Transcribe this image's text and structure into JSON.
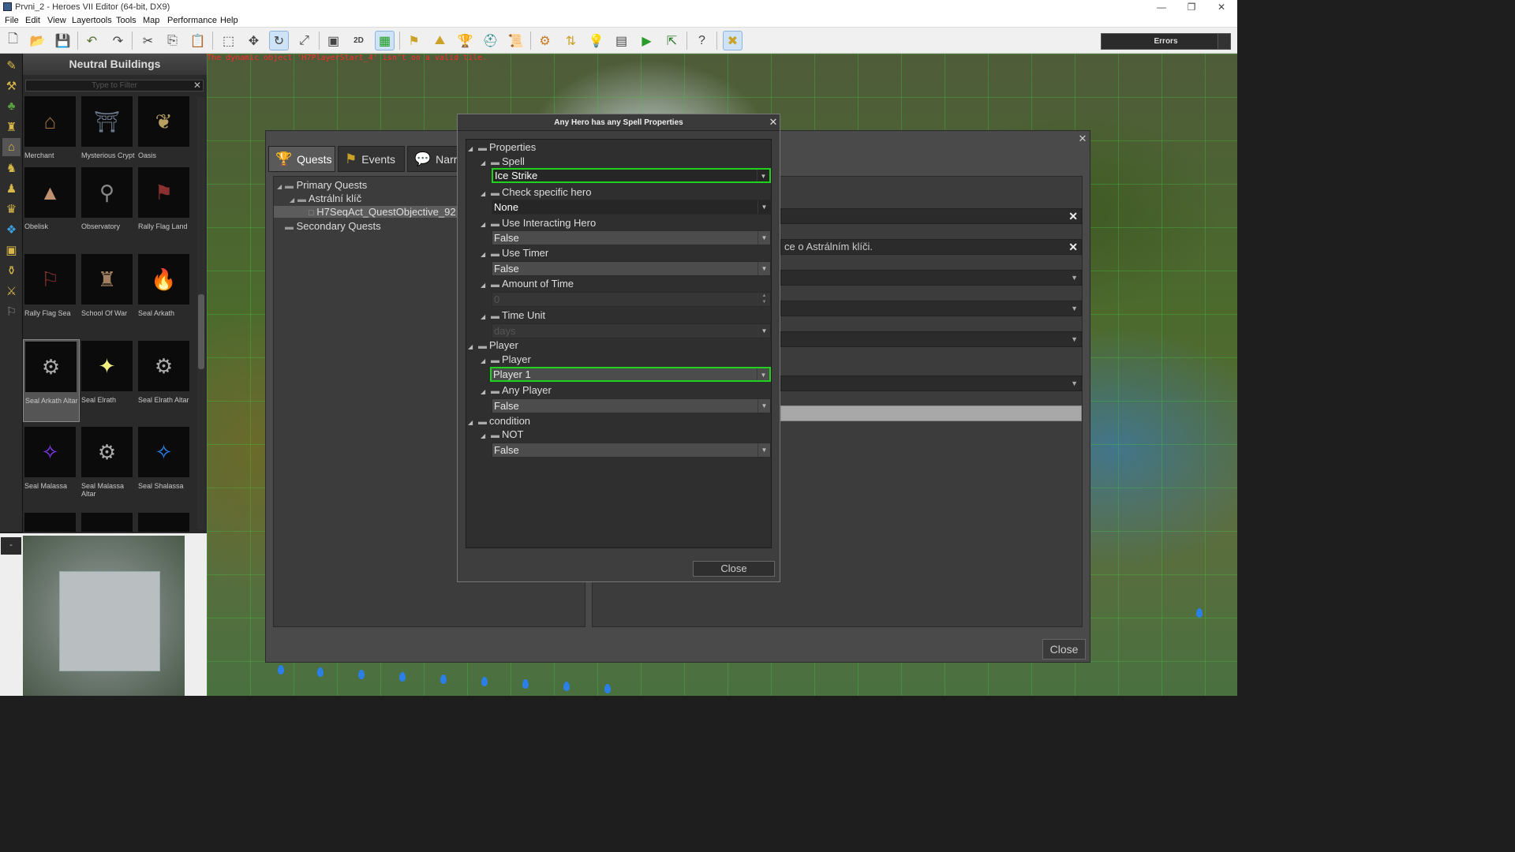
{
  "window": {
    "title": "Prvni_2 - Heroes VII Editor (64-bit, DX9)",
    "minimize": "—",
    "maximize": "❐",
    "close": "✕"
  },
  "menu": [
    "File",
    "Edit",
    "View",
    "Layertools",
    "Tools",
    "Map",
    "Performance",
    "Help"
  ],
  "toolbar": {
    "errors_label": "Errors"
  },
  "viewport": {
    "error_message": "The dynamic object 'H7PlayerStart_4' isn't on a valid tile."
  },
  "neutral_buildings": {
    "title": "Neutral Buildings",
    "filter_placeholder": "Type to Filter",
    "items": [
      {
        "label": "Merchant"
      },
      {
        "label": "Mysterious Crypt"
      },
      {
        "label": "Oasis"
      },
      {
        "label": "Obelisk"
      },
      {
        "label": "Observatory"
      },
      {
        "label": "Rally Flag Land"
      },
      {
        "label": "Rally Flag Sea"
      },
      {
        "label": "School Of War"
      },
      {
        "label": "Seal Arkath"
      },
      {
        "label": "Seal Arkath Altar"
      },
      {
        "label": "Seal Elrath"
      },
      {
        "label": "Seal Elrath Altar"
      },
      {
        "label": "Seal Malassa"
      },
      {
        "label": "Seal Malassa Altar"
      },
      {
        "label": "Seal Shalassa"
      }
    ]
  },
  "minimap": {
    "button": "-"
  },
  "quest_dialog": {
    "tabs": [
      {
        "label": "Quests"
      },
      {
        "label": "Events"
      },
      {
        "label": "Narr"
      }
    ],
    "tree": [
      {
        "label": "Primary Quests"
      },
      {
        "label": "Astrální klíč"
      },
      {
        "label": "H7SeqAct_QuestObjective_92"
      },
      {
        "label": "Secondary Quests"
      }
    ],
    "description_text": "ce o Astrálním klíči.",
    "close_label": "Close"
  },
  "properties_dialog": {
    "title": "Any Hero has any Spell Properties",
    "groups": {
      "properties": "Properties",
      "spell": "Spell",
      "spell_value": "Ice Strike",
      "check_hero": "Check specific hero",
      "check_hero_value": "None",
      "use_interacting": "Use Interacting Hero",
      "use_interacting_value": "False",
      "use_timer": "Use Timer",
      "use_timer_value": "False",
      "amount_time": "Amount of Time",
      "amount_time_value": "0",
      "time_unit": "Time Unit",
      "time_unit_value": "days",
      "player_group": "Player",
      "player": "Player",
      "player_value": "Player 1",
      "any_player": "Any Player",
      "any_player_value": "False",
      "condition": "condition",
      "not": "NOT",
      "not_value": "False"
    },
    "close_label": "Close"
  },
  "colors": {
    "highlight": "#1ed21e",
    "error_text": "#ff2a2a",
    "panel": "#3e3e3e"
  }
}
